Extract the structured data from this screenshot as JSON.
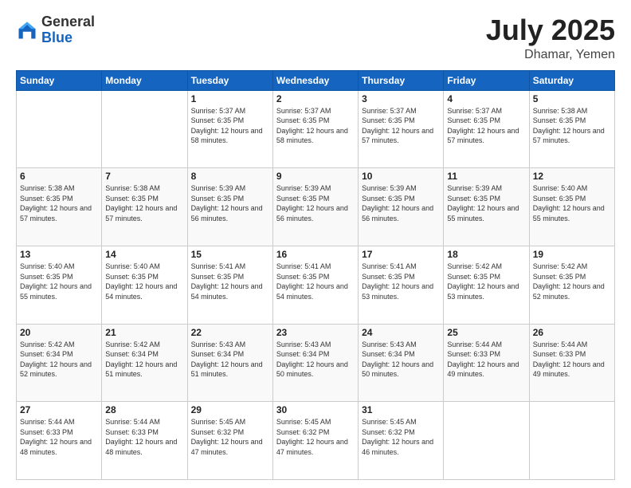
{
  "header": {
    "logo_general": "General",
    "logo_blue": "Blue",
    "title": "July 2025",
    "location": "Dhamar, Yemen"
  },
  "days_of_week": [
    "Sunday",
    "Monday",
    "Tuesday",
    "Wednesday",
    "Thursday",
    "Friday",
    "Saturday"
  ],
  "weeks": [
    [
      {
        "day": "",
        "sunrise": "",
        "sunset": "",
        "daylight": ""
      },
      {
        "day": "",
        "sunrise": "",
        "sunset": "",
        "daylight": ""
      },
      {
        "day": "1",
        "sunrise": "Sunrise: 5:37 AM",
        "sunset": "Sunset: 6:35 PM",
        "daylight": "Daylight: 12 hours and 58 minutes."
      },
      {
        "day": "2",
        "sunrise": "Sunrise: 5:37 AM",
        "sunset": "Sunset: 6:35 PM",
        "daylight": "Daylight: 12 hours and 58 minutes."
      },
      {
        "day": "3",
        "sunrise": "Sunrise: 5:37 AM",
        "sunset": "Sunset: 6:35 PM",
        "daylight": "Daylight: 12 hours and 57 minutes."
      },
      {
        "day": "4",
        "sunrise": "Sunrise: 5:37 AM",
        "sunset": "Sunset: 6:35 PM",
        "daylight": "Daylight: 12 hours and 57 minutes."
      },
      {
        "day": "5",
        "sunrise": "Sunrise: 5:38 AM",
        "sunset": "Sunset: 6:35 PM",
        "daylight": "Daylight: 12 hours and 57 minutes."
      }
    ],
    [
      {
        "day": "6",
        "sunrise": "Sunrise: 5:38 AM",
        "sunset": "Sunset: 6:35 PM",
        "daylight": "Daylight: 12 hours and 57 minutes."
      },
      {
        "day": "7",
        "sunrise": "Sunrise: 5:38 AM",
        "sunset": "Sunset: 6:35 PM",
        "daylight": "Daylight: 12 hours and 57 minutes."
      },
      {
        "day": "8",
        "sunrise": "Sunrise: 5:39 AM",
        "sunset": "Sunset: 6:35 PM",
        "daylight": "Daylight: 12 hours and 56 minutes."
      },
      {
        "day": "9",
        "sunrise": "Sunrise: 5:39 AM",
        "sunset": "Sunset: 6:35 PM",
        "daylight": "Daylight: 12 hours and 56 minutes."
      },
      {
        "day": "10",
        "sunrise": "Sunrise: 5:39 AM",
        "sunset": "Sunset: 6:35 PM",
        "daylight": "Daylight: 12 hours and 56 minutes."
      },
      {
        "day": "11",
        "sunrise": "Sunrise: 5:39 AM",
        "sunset": "Sunset: 6:35 PM",
        "daylight": "Daylight: 12 hours and 55 minutes."
      },
      {
        "day": "12",
        "sunrise": "Sunrise: 5:40 AM",
        "sunset": "Sunset: 6:35 PM",
        "daylight": "Daylight: 12 hours and 55 minutes."
      }
    ],
    [
      {
        "day": "13",
        "sunrise": "Sunrise: 5:40 AM",
        "sunset": "Sunset: 6:35 PM",
        "daylight": "Daylight: 12 hours and 55 minutes."
      },
      {
        "day": "14",
        "sunrise": "Sunrise: 5:40 AM",
        "sunset": "Sunset: 6:35 PM",
        "daylight": "Daylight: 12 hours and 54 minutes."
      },
      {
        "day": "15",
        "sunrise": "Sunrise: 5:41 AM",
        "sunset": "Sunset: 6:35 PM",
        "daylight": "Daylight: 12 hours and 54 minutes."
      },
      {
        "day": "16",
        "sunrise": "Sunrise: 5:41 AM",
        "sunset": "Sunset: 6:35 PM",
        "daylight": "Daylight: 12 hours and 54 minutes."
      },
      {
        "day": "17",
        "sunrise": "Sunrise: 5:41 AM",
        "sunset": "Sunset: 6:35 PM",
        "daylight": "Daylight: 12 hours and 53 minutes."
      },
      {
        "day": "18",
        "sunrise": "Sunrise: 5:42 AM",
        "sunset": "Sunset: 6:35 PM",
        "daylight": "Daylight: 12 hours and 53 minutes."
      },
      {
        "day": "19",
        "sunrise": "Sunrise: 5:42 AM",
        "sunset": "Sunset: 6:35 PM",
        "daylight": "Daylight: 12 hours and 52 minutes."
      }
    ],
    [
      {
        "day": "20",
        "sunrise": "Sunrise: 5:42 AM",
        "sunset": "Sunset: 6:34 PM",
        "daylight": "Daylight: 12 hours and 52 minutes."
      },
      {
        "day": "21",
        "sunrise": "Sunrise: 5:42 AM",
        "sunset": "Sunset: 6:34 PM",
        "daylight": "Daylight: 12 hours and 51 minutes."
      },
      {
        "day": "22",
        "sunrise": "Sunrise: 5:43 AM",
        "sunset": "Sunset: 6:34 PM",
        "daylight": "Daylight: 12 hours and 51 minutes."
      },
      {
        "day": "23",
        "sunrise": "Sunrise: 5:43 AM",
        "sunset": "Sunset: 6:34 PM",
        "daylight": "Daylight: 12 hours and 50 minutes."
      },
      {
        "day": "24",
        "sunrise": "Sunrise: 5:43 AM",
        "sunset": "Sunset: 6:34 PM",
        "daylight": "Daylight: 12 hours and 50 minutes."
      },
      {
        "day": "25",
        "sunrise": "Sunrise: 5:44 AM",
        "sunset": "Sunset: 6:33 PM",
        "daylight": "Daylight: 12 hours and 49 minutes."
      },
      {
        "day": "26",
        "sunrise": "Sunrise: 5:44 AM",
        "sunset": "Sunset: 6:33 PM",
        "daylight": "Daylight: 12 hours and 49 minutes."
      }
    ],
    [
      {
        "day": "27",
        "sunrise": "Sunrise: 5:44 AM",
        "sunset": "Sunset: 6:33 PM",
        "daylight": "Daylight: 12 hours and 48 minutes."
      },
      {
        "day": "28",
        "sunrise": "Sunrise: 5:44 AM",
        "sunset": "Sunset: 6:33 PM",
        "daylight": "Daylight: 12 hours and 48 minutes."
      },
      {
        "day": "29",
        "sunrise": "Sunrise: 5:45 AM",
        "sunset": "Sunset: 6:32 PM",
        "daylight": "Daylight: 12 hours and 47 minutes."
      },
      {
        "day": "30",
        "sunrise": "Sunrise: 5:45 AM",
        "sunset": "Sunset: 6:32 PM",
        "daylight": "Daylight: 12 hours and 47 minutes."
      },
      {
        "day": "31",
        "sunrise": "Sunrise: 5:45 AM",
        "sunset": "Sunset: 6:32 PM",
        "daylight": "Daylight: 12 hours and 46 minutes."
      },
      {
        "day": "",
        "sunrise": "",
        "sunset": "",
        "daylight": ""
      },
      {
        "day": "",
        "sunrise": "",
        "sunset": "",
        "daylight": ""
      }
    ]
  ]
}
